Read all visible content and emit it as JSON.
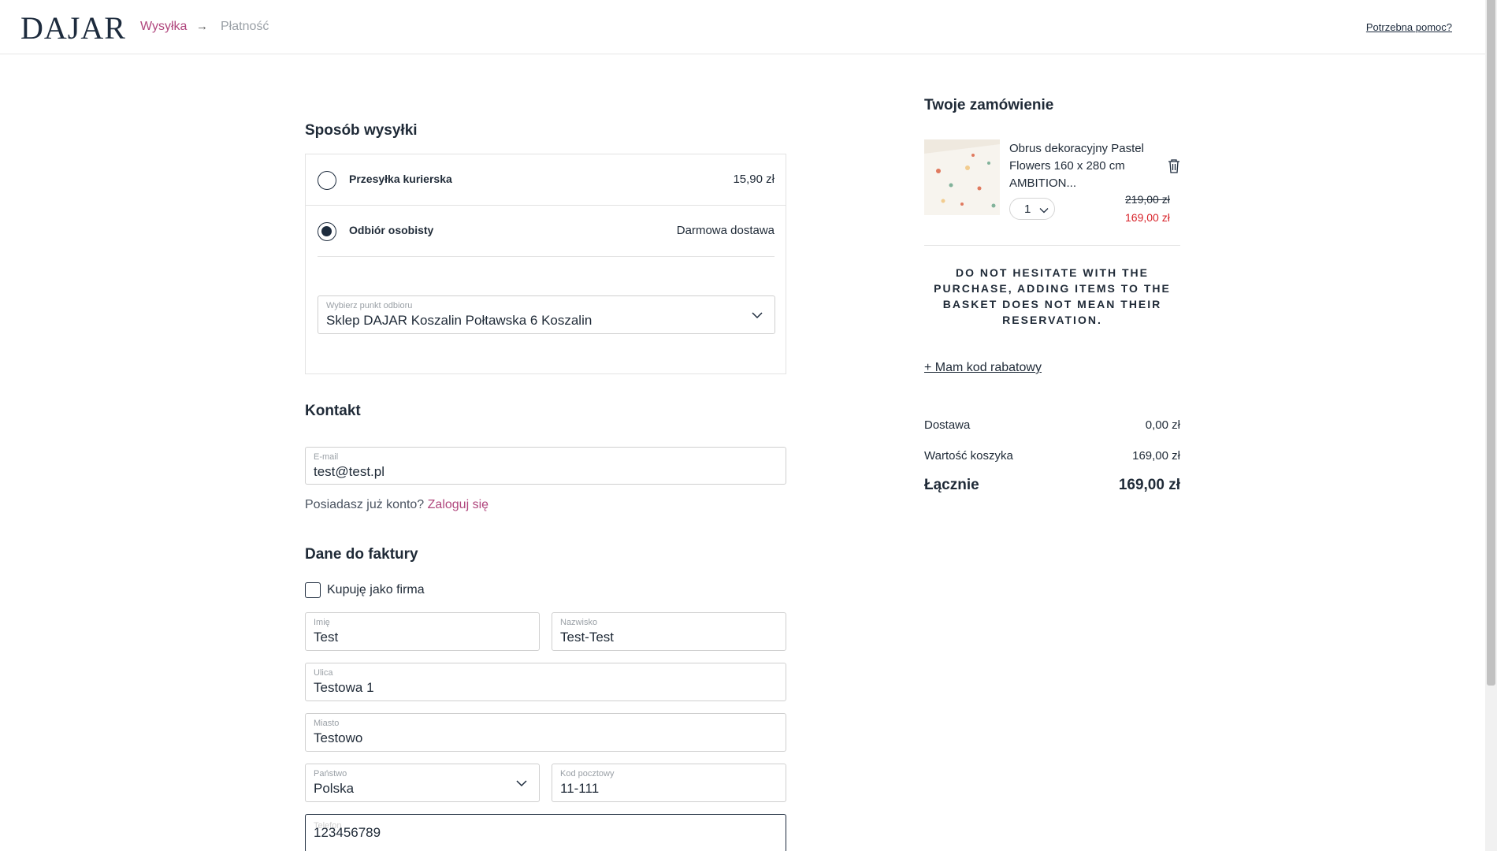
{
  "header": {
    "logo": "DAJAR",
    "breadcrumb": [
      {
        "label": "Wysyłka"
      },
      {
        "label": "Płatność"
      }
    ],
    "help_link": "Potrzebna pomoc?"
  },
  "shipping": {
    "title": "Sposób wysyłki",
    "options": [
      {
        "label": "Przesyłka kurierska",
        "price": "15,90 zł",
        "selected": false
      },
      {
        "label": "Odbiór osobisty",
        "price": "Darmowa dostawa",
        "selected": true
      }
    ],
    "pickup": {
      "label": "Wybierz punkt odbioru",
      "value": "Sklep DAJAR Koszalin Połtawska 6 Koszalin"
    }
  },
  "contact": {
    "title": "Kontakt",
    "email_label": "E-mail",
    "email_value": "test@test.pl",
    "login_prompt": "Posiadasz już konto?",
    "login_link": "Zaloguj się"
  },
  "invoice": {
    "title": "Dane do faktury",
    "company_checkbox": "Kupuję jako firma",
    "first_name": {
      "label": "Imię",
      "value": "Test"
    },
    "last_name": {
      "label": "Nazwisko",
      "value": "Test-Test"
    },
    "street": {
      "label": "Ulica",
      "value": "Testowa 1"
    },
    "city": {
      "label": "Miasto",
      "value": "Testowo"
    },
    "country": {
      "label": "Państwo",
      "value": "Polska"
    },
    "postcode": {
      "label": "Kod pocztowy",
      "value": "11-111"
    },
    "phone": {
      "label": "Telefon",
      "value": "123456789"
    }
  },
  "order": {
    "title": "Twoje zamówienie",
    "item": {
      "name": "Obrus dekoracyjny Pastel Flowers 160 x 280 cm AMBITION...",
      "quantity": "1",
      "old_price": "219,00 zł",
      "price": "169,00 zł"
    },
    "notice": "DO NOT HESITATE WITH THE PURCHASE, ADDING ITEMS TO THE BASKET DOES NOT MEAN THEIR RESERVATION.",
    "promo_link": "+ Mam kod rabatowy",
    "summary": [
      {
        "label": "Dostawa",
        "value": "0,00 zł"
      },
      {
        "label": "Wartość koszyka",
        "value": "169,00 zł"
      }
    ],
    "total": {
      "label": "Łącznie",
      "value": "169,00 zł"
    }
  },
  "colors": {
    "accent": "#b0467d",
    "dark": "#1d2b3d",
    "sale": "#d8232a"
  }
}
